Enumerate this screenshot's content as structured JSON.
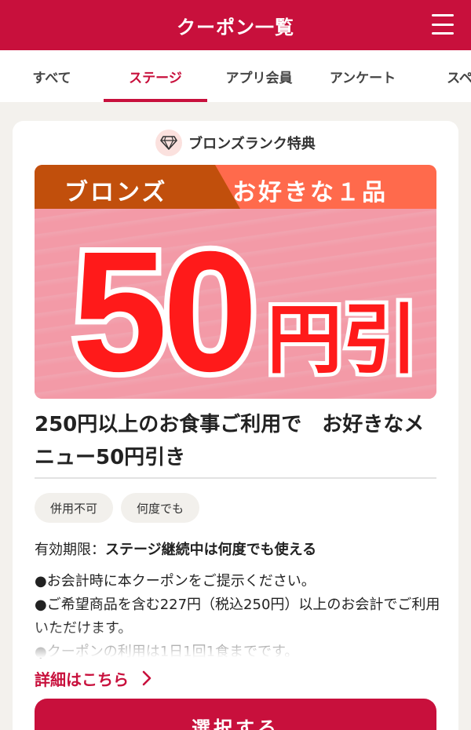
{
  "header": {
    "title": "クーポン一覧"
  },
  "tabs": [
    {
      "label": "すべて"
    },
    {
      "label": "ステージ"
    },
    {
      "label": "アプリ会員"
    },
    {
      "label": "アンケート"
    },
    {
      "label": "スペシ"
    }
  ],
  "active_tab": "ステージ",
  "card": {
    "rank_label": "ブロンズランク特典",
    "banner": {
      "tag": "ブロンズ",
      "subtitle": "お好きな１品",
      "amount": "50",
      "suffix": "円引"
    },
    "title": "250円以上のお食事ご利用で　お好きなメニュー50円引き",
    "chips": [
      "併用不可",
      "何度でも"
    ],
    "validity_label": "有効期限：",
    "validity_value": "ステージ継続中は何度でも使える",
    "notes": [
      "●お会計時に本クーポンをご提示ください。",
      "●ご希望商品を含む227円（税込250円）以上のお会計でご利用いただけます。",
      "●クーポンの利用は1日1回1食までです。"
    ],
    "details_link": "詳細はこちら",
    "select_button": "選択する"
  },
  "colors": {
    "brand": "#c8103c",
    "banner_tag": "#c14f0c",
    "banner_sub": "#ff6a4c",
    "banner_bg": "#f29aa8",
    "amount_red": "#ff1a1a"
  }
}
